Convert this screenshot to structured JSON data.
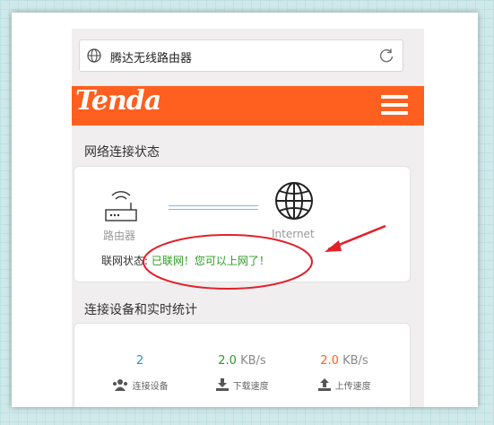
{
  "browser": {
    "title": "腾达无线路由器"
  },
  "brand": {
    "logo": "Tenda",
    "accent": "#ff5f1f"
  },
  "connection_section": {
    "title": "网络连接状态",
    "router_label": "路由器",
    "internet_label": "Internet",
    "status_prefix": "联网状态: ",
    "status_text": "已联网！您可以上网了！",
    "status_color": "#2a9d20"
  },
  "stats_section": {
    "title": "连接设备和实时统计",
    "devices": {
      "value": "2",
      "label": "连接设备"
    },
    "download": {
      "value": "2.0",
      "unit": " KB/s",
      "label": "下载速度"
    },
    "upload": {
      "value": "2.0",
      "unit": " KB/s",
      "label": "上传速度"
    }
  },
  "annotation": {
    "color": "#e0202a"
  }
}
